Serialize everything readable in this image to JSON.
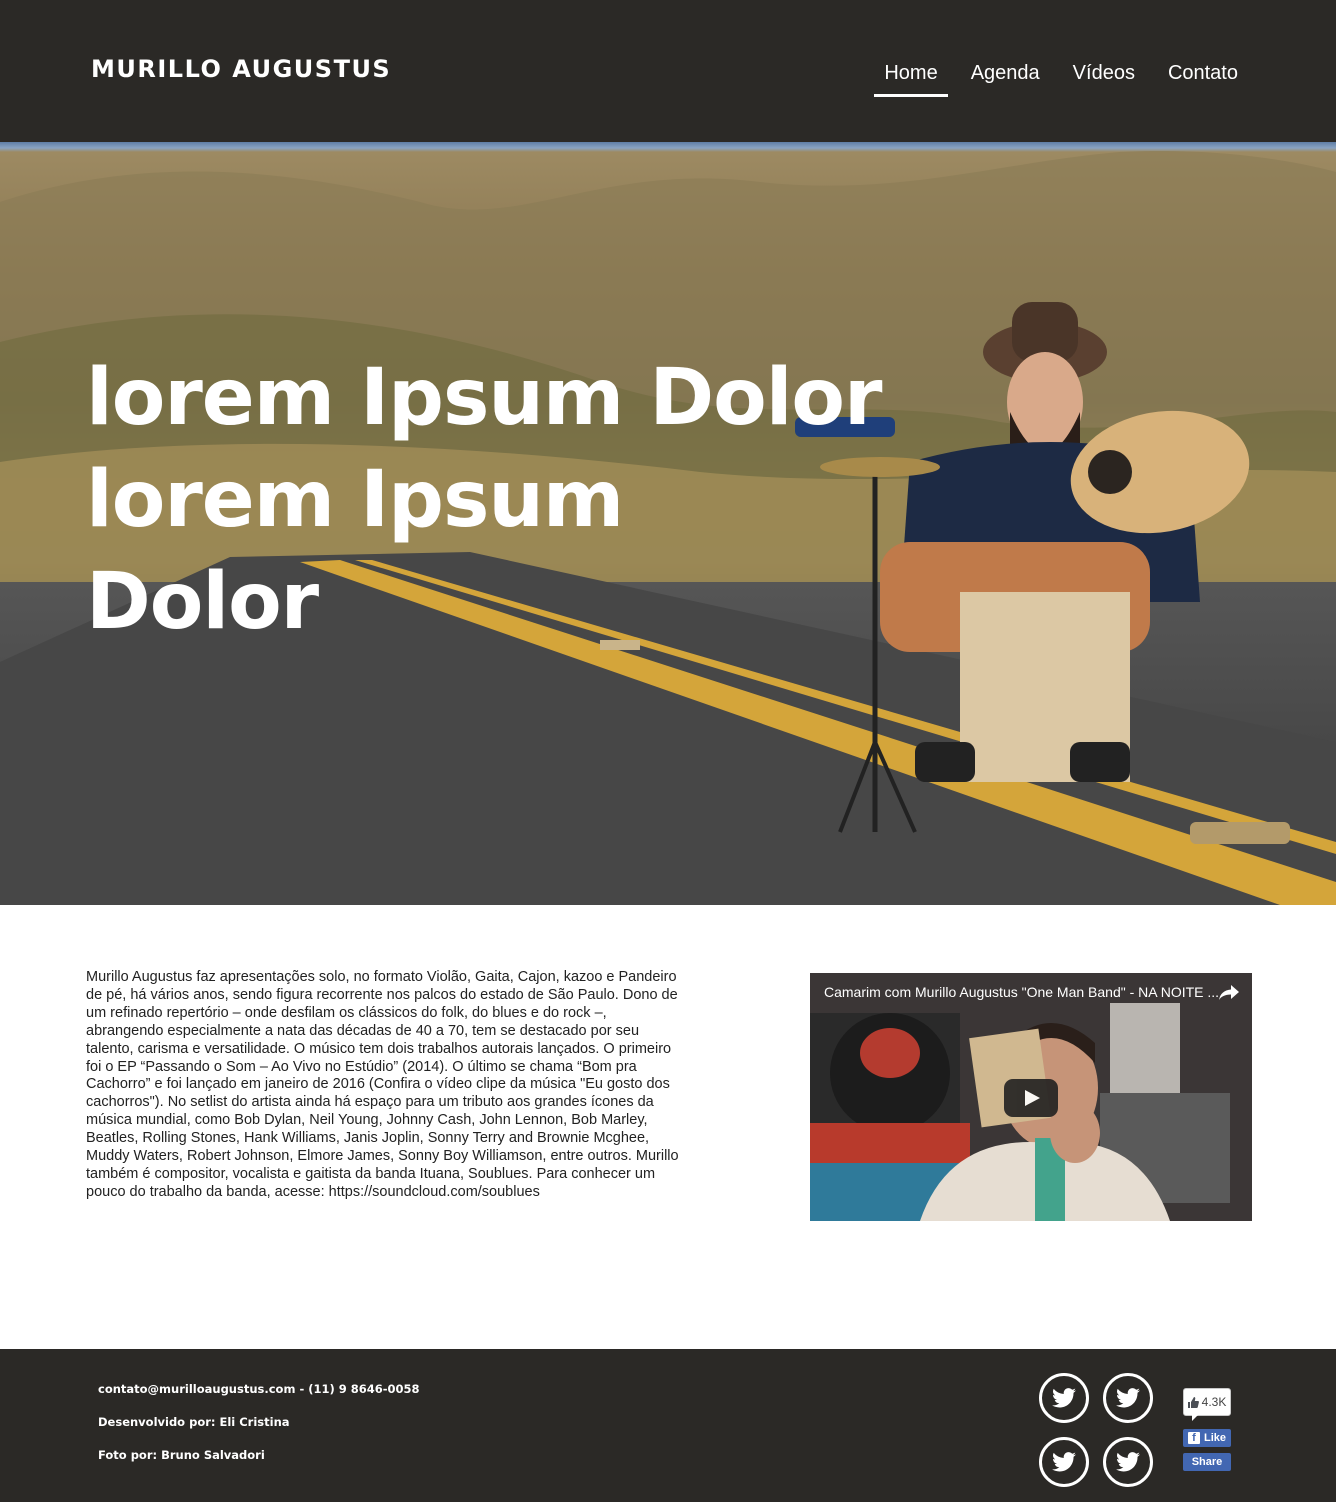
{
  "header": {
    "logo": "MURILLO AUGUSTUS",
    "nav": [
      {
        "label": "Home",
        "active": true
      },
      {
        "label": "Agenda",
        "active": false
      },
      {
        "label": "Vídeos",
        "active": false
      },
      {
        "label": "Contato",
        "active": false
      }
    ]
  },
  "hero": {
    "title_lines": [
      "lorem Ipsum Dolor",
      "lorem Ipsum",
      "Dolor"
    ]
  },
  "bio": {
    "text": "Murillo Augustus faz apresentações solo, no formato Violão, Gaita, Cajon, kazoo e Pandeiro de pé, há vários anos, sendo figura recorrente nos palcos do estado de São Paulo. Dono de um refinado repertório – onde desfilam os clássicos do folk, do blues e do rock –, abrangendo especialmente a nata das décadas de 40 a 70, tem se destacado por seu talento, carisma e versatilidade. O músico tem dois trabalhos autorais lançados. O primeiro foi o EP “Passando o Som – Ao Vivo no Estúdio” (2014). O último se chama “Bom pra Cachorro” e foi lançado em janeiro de 2016 (Confira o vídeo clipe da música \"Eu gosto dos cachorros\"). No setlist do artista ainda há espaço para um tributo aos grandes ícones da música mundial, como Bob Dylan, Neil Young, Johnny Cash, John Lennon, Bob Marley, Beatles, Rolling Stones, Hank Williams, Janis Joplin, Sonny Terry and Brownie Mcghee, Muddy Waters, Robert Johnson, Elmore James, Sonny Boy Williamson, entre outros. Murillo também é compositor, vocalista e gaitista da banda Ituana, Soublues. Para conhecer um pouco do trabalho da banda, acesse: https://soundcloud.com/soublues"
  },
  "video": {
    "title": "Camarim com Murillo Augustus \"One Man Band\" - NA NOITE ...",
    "share_icon": "share-icon",
    "play_icon": "play-icon"
  },
  "footer": {
    "contact": "contato@murilloaugustus.com - (11) 9 8646-0058",
    "dev": "Desenvolvido por: Eli Cristina",
    "photo": "Foto por: Bruno Salvadori",
    "social_icons": [
      "twitter-icon",
      "twitter-icon",
      "twitter-icon",
      "twitter-icon"
    ],
    "fb_count": "4.3K",
    "fb_like": "Like",
    "fb_share": "Share"
  },
  "colors": {
    "header_bg": "#2b2926",
    "footer_bg": "#2b2926",
    "facebook": "#4267b2"
  }
}
